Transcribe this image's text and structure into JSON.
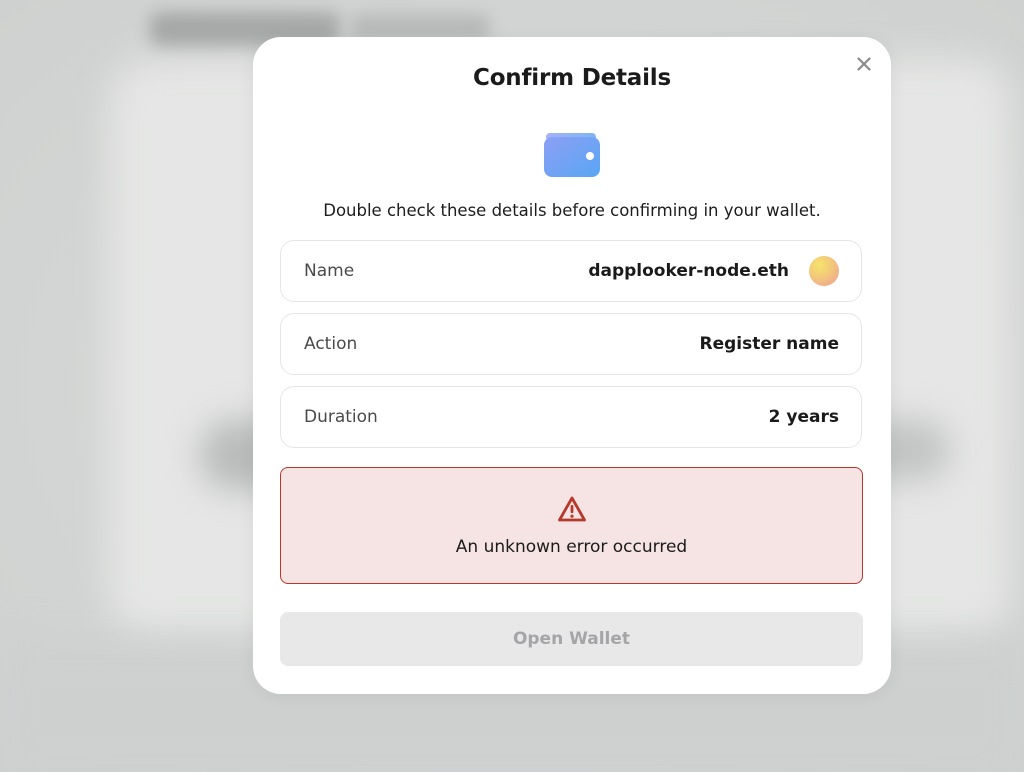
{
  "modal": {
    "title": "Confirm Details",
    "subtitle": "Double check these details before confirming in your wallet.",
    "close_icon": "close-icon",
    "wallet_icon": "wallet-icon",
    "rows": [
      {
        "label": "Name",
        "value": "dapplooker-node.eth",
        "has_avatar": true
      },
      {
        "label": "Action",
        "value": "Register name"
      },
      {
        "label": "Duration",
        "value": "2 years"
      }
    ],
    "error": {
      "icon": "warning-icon",
      "message": "An unknown error occurred"
    },
    "primary_button": {
      "label": "Open Wallet",
      "state": "disabled"
    }
  },
  "colors": {
    "error_border": "#b6382b",
    "error_background": "#f6e4e4",
    "wallet_gradient_start": "#8fa2f5",
    "wallet_gradient_end": "#5aa4f2",
    "disabled_button_bg": "#e8e8e9",
    "disabled_button_text": "#a5a5a8"
  }
}
